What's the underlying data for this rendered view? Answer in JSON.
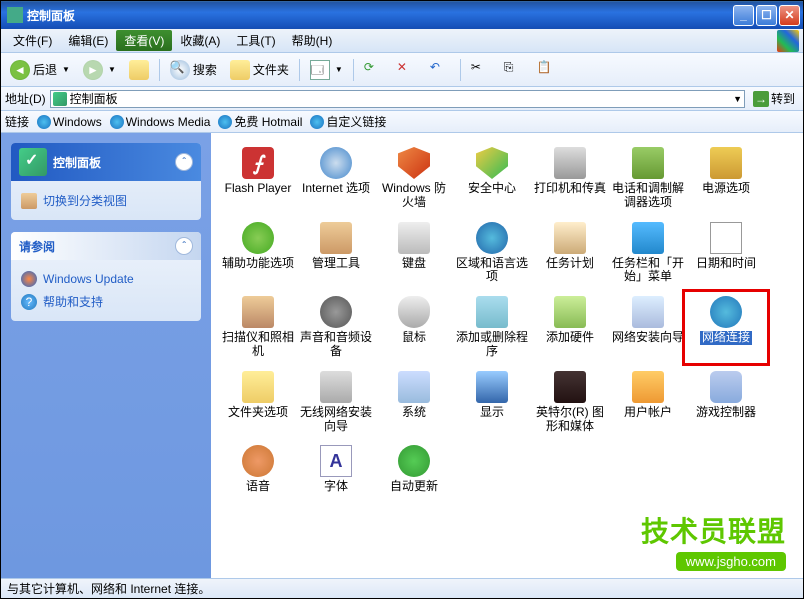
{
  "window": {
    "title": "控制面板"
  },
  "menu": {
    "file": "文件(F)",
    "edit": "编辑(E)",
    "view": "查看(V)",
    "fav": "收藏(A)",
    "tools": "工具(T)",
    "help": "帮助(H)"
  },
  "toolbar": {
    "back": "后退",
    "search": "搜索",
    "folders": "文件夹"
  },
  "address": {
    "label": "地址(D)",
    "value": "控制面板",
    "go": "转到"
  },
  "links": {
    "label": "链接",
    "l1": "Windows",
    "l2": "Windows Media",
    "l3": "免费 Hotmail",
    "l4": "自定义链接"
  },
  "side": {
    "panel1": {
      "title": "控制面板",
      "switch": "切换到分类视图"
    },
    "panel2": {
      "title": "请参阅",
      "wu": "Windows Update",
      "help": "帮助和支持"
    }
  },
  "items": [
    {
      "id": "flash",
      "label": "Flash Player",
      "ico": "i-flash"
    },
    {
      "id": "inet",
      "label": "Internet 选项",
      "ico": "i-net"
    },
    {
      "id": "fw",
      "label": "Windows 防火墙",
      "ico": "i-shield"
    },
    {
      "id": "sec",
      "label": "安全中心",
      "ico": "i-sec"
    },
    {
      "id": "print",
      "label": "打印机和传真",
      "ico": "i-print"
    },
    {
      "id": "phone",
      "label": "电话和调制解调器选项",
      "ico": "i-phone"
    },
    {
      "id": "power",
      "label": "电源选项",
      "ico": "i-power"
    },
    {
      "id": "acc",
      "label": "辅助功能选项",
      "ico": "i-acc"
    },
    {
      "id": "admin",
      "label": "管理工具",
      "ico": "i-admin"
    },
    {
      "id": "kb",
      "label": "键盘",
      "ico": "i-kb"
    },
    {
      "id": "region",
      "label": "区域和语言选项",
      "ico": "i-globe"
    },
    {
      "id": "task",
      "label": "任务计划",
      "ico": "i-task"
    },
    {
      "id": "tbar",
      "label": "任务栏和「开始」菜单",
      "ico": "i-tbar"
    },
    {
      "id": "date",
      "label": "日期和时间",
      "ico": "i-date"
    },
    {
      "id": "scan",
      "label": "扫描仪和照相机",
      "ico": "i-scan"
    },
    {
      "id": "sound",
      "label": "声音和音频设备",
      "ico": "i-sound"
    },
    {
      "id": "mouse",
      "label": "鼠标",
      "ico": "i-mouse"
    },
    {
      "id": "addrem",
      "label": "添加或删除程序",
      "ico": "i-addrem"
    },
    {
      "id": "addhw",
      "label": "添加硬件",
      "ico": "i-addhw"
    },
    {
      "id": "netwiz",
      "label": "网络安装向导",
      "ico": "i-netwiz"
    },
    {
      "id": "netconn",
      "label": "网络连接",
      "ico": "i-netconn",
      "selected": true
    },
    {
      "id": "folder",
      "label": "文件夹选项",
      "ico": "i-folder"
    },
    {
      "id": "wifi",
      "label": "无线网络安装向导",
      "ico": "i-wifi"
    },
    {
      "id": "sys",
      "label": "系统",
      "ico": "i-sys"
    },
    {
      "id": "disp",
      "label": "显示",
      "ico": "i-disp"
    },
    {
      "id": "intel",
      "label": "英特尔(R) 图形和媒体",
      "ico": "i-intel"
    },
    {
      "id": "user",
      "label": "用户帐户",
      "ico": "i-user"
    },
    {
      "id": "game",
      "label": "游戏控制器",
      "ico": "i-game"
    },
    {
      "id": "speech",
      "label": "语音",
      "ico": "i-speech"
    },
    {
      "id": "font",
      "label": "字体",
      "ico": "i-font"
    },
    {
      "id": "update",
      "label": "自动更新",
      "ico": "i-update"
    }
  ],
  "status": "与其它计算机、网络和 Internet 连接。",
  "watermark": {
    "line1": "技术员联盟",
    "line2": "www.jsgho.com"
  }
}
